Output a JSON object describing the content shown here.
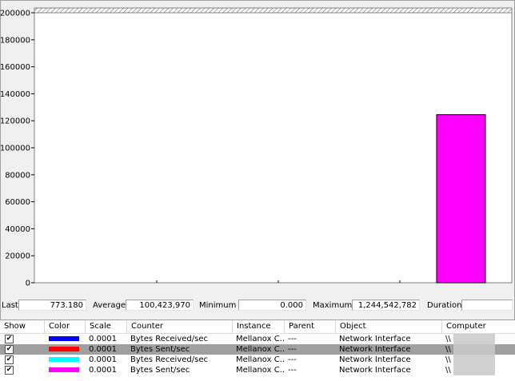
{
  "chart_data": {
    "type": "bar",
    "ylim": [
      0,
      200000
    ],
    "yticks": [
      0,
      20000,
      40000,
      60000,
      80000,
      100000,
      120000,
      140000,
      160000,
      180000,
      200000
    ],
    "ytick_labels": [
      "0",
      "20000",
      "40000",
      "60000",
      "80000",
      "100000",
      "120000",
      "140000",
      "160000",
      "180000",
      "200000"
    ],
    "values": [
      124500
    ],
    "bar_color": "#ff00ff",
    "grid": false
  },
  "stats": {
    "last_label": "Last",
    "last_value": "773.180",
    "average_label": "Average",
    "average_value": "100,423,970",
    "minimum_label": "Minimum",
    "minimum_value": "0.000",
    "maximum_label": "Maximum",
    "maximum_value": "1,244,542,782",
    "duration_label": "Duration",
    "duration_value": ""
  },
  "table": {
    "headers": [
      "Show",
      "Color",
      "Scale",
      "Counter",
      "Instance",
      "Parent",
      "Object",
      "Computer"
    ],
    "rows": [
      {
        "show": true,
        "color": "#0000ff",
        "scale": "0.0001",
        "counter": "Bytes Received/sec",
        "instance": "Mellanox C...",
        "parent": "---",
        "object": "Network Interface",
        "computer": "\\\\",
        "selected": false
      },
      {
        "show": true,
        "color": "#ff0000",
        "scale": "0.0001",
        "counter": "Bytes Sent/sec",
        "instance": "Mellanox C...",
        "parent": "---",
        "object": "Network Interface",
        "computer": "\\\\",
        "selected": true
      },
      {
        "show": true,
        "color": "#00ffff",
        "scale": "0.0001",
        "counter": "Bytes Received/sec",
        "instance": "Mellanox C...",
        "parent": "---",
        "object": "Network Interface",
        "computer": "\\\\",
        "selected": false
      },
      {
        "show": true,
        "color": "#ff00ff",
        "scale": "0.0001",
        "counter": "Bytes Sent/sec",
        "instance": "Mellanox C...",
        "parent": "---",
        "object": "Network Interface",
        "computer": "\\\\",
        "selected": false
      }
    ]
  }
}
